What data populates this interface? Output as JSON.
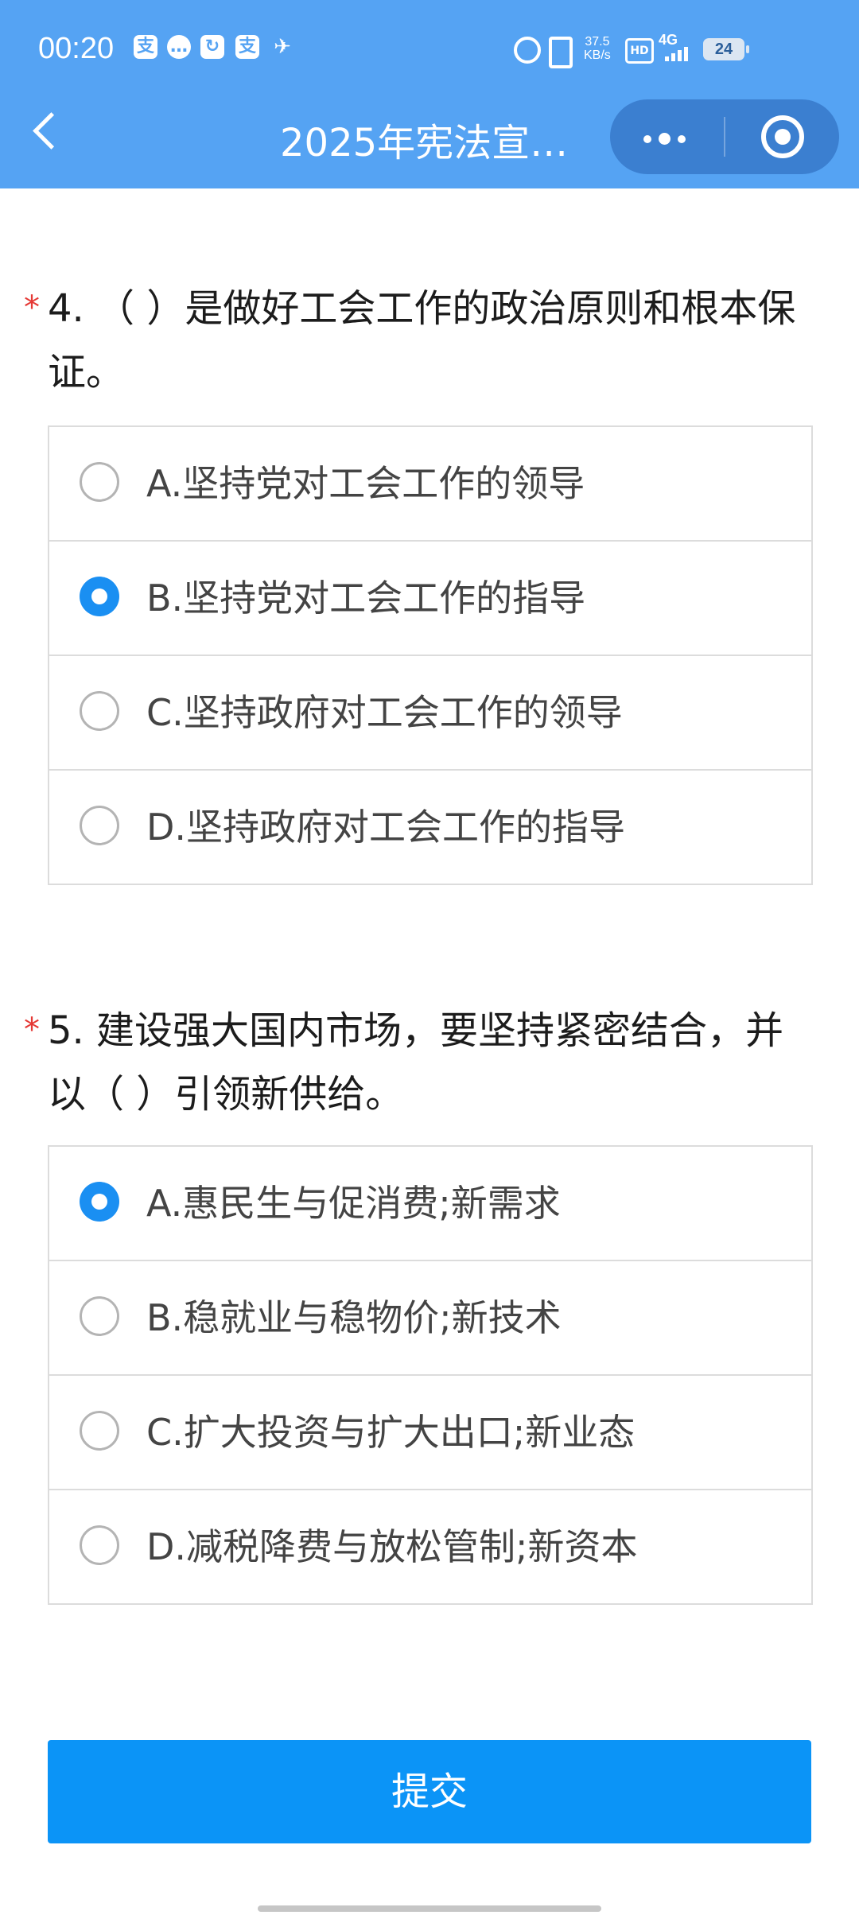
{
  "status_bar": {
    "time": "00:20",
    "app_icons": [
      "alipay-icon",
      "chat-bubble-icon",
      "share-icon",
      "alipay-icon",
      "bird-icon"
    ],
    "net_speed_value": "37.5",
    "net_speed_unit": "KB/s",
    "hd": "HD",
    "network": "4G",
    "battery": "24"
  },
  "nav": {
    "title": "2025年宪法宣…",
    "accent": "#55a3f3"
  },
  "questions": [
    {
      "required_mark": "*",
      "text": "4. （ ）是做好工会工作的政治原则和根本保证。",
      "options": [
        {
          "label": "A.坚持党对工会工作的领导",
          "selected": false
        },
        {
          "label": "B.坚持党对工会工作的指导",
          "selected": true
        },
        {
          "label": "C.坚持政府对工会工作的领导",
          "selected": false
        },
        {
          "label": "D.坚持政府对工会工作的指导",
          "selected": false
        }
      ]
    },
    {
      "required_mark": "*",
      "text": "5. 建设强大国内市场，要坚持紧密结合，并以（ ）引领新供给。",
      "options": [
        {
          "label": "A.惠民生与促消费;新需求",
          "selected": true
        },
        {
          "label": "B.稳就业与稳物价;新技术",
          "selected": false
        },
        {
          "label": "C.扩大投资与扩大出口;新业态",
          "selected": false
        },
        {
          "label": "D.减税降费与放松管制;新资本",
          "selected": false
        }
      ]
    }
  ],
  "submit": {
    "label": "提交",
    "color": "#0b94f7"
  },
  "selected_color": "#1a8ff2"
}
